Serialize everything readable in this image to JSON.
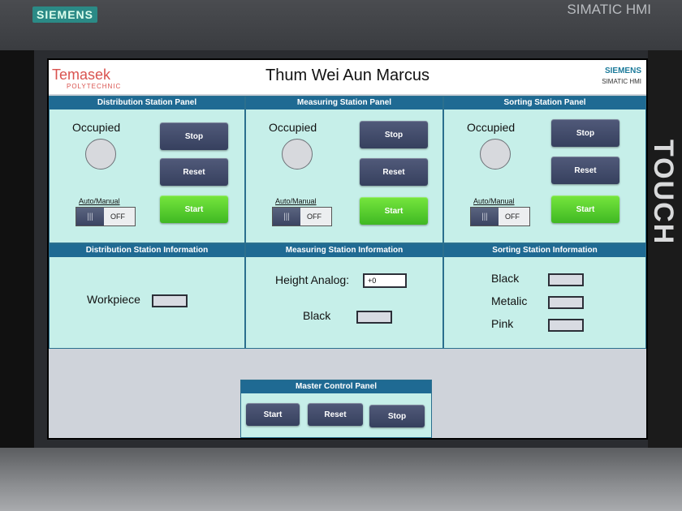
{
  "device": {
    "brand_badge": "SIEMENS",
    "hmi_label": "SIMATIC HMI",
    "touch_label": "TOUCH"
  },
  "header": {
    "logo_text": "Temasek",
    "logo_sub": "POLYTECHNIC",
    "title": "Thum Wei Aun Marcus",
    "corner_brand": "SIEMENS",
    "corner_sub": "SIMATIC HMI"
  },
  "stations": [
    {
      "panel_title": "Distribution Station Panel",
      "status_label": "Occupied",
      "stop_label": "Stop",
      "reset_label": "Reset",
      "start_label": "Start",
      "mode_label": "Auto/Manual",
      "toggle_state": "OFF"
    },
    {
      "panel_title": "Measuring Station Panel",
      "status_label": "Occupied",
      "stop_label": "Stop",
      "reset_label": "Reset",
      "start_label": "Start",
      "mode_label": "Auto/Manual",
      "toggle_state": "OFF"
    },
    {
      "panel_title": "Sorting Station Panel",
      "status_label": "Occupied",
      "stop_label": "Stop",
      "reset_label": "Reset",
      "start_label": "Start",
      "mode_label": "Auto/Manual",
      "toggle_state": "OFF"
    }
  ],
  "info": {
    "distribution": {
      "title": "Distribution Station Information",
      "workpiece_label": "Workpiece"
    },
    "measuring": {
      "title": "Measuring Station Information",
      "height_label": "Height Analog:",
      "height_value": "+0",
      "black_label": "Black"
    },
    "sorting": {
      "title": "Sorting Station Information",
      "black_label": "Black",
      "metalic_label": "Metalic",
      "pink_label": "Pink"
    }
  },
  "master": {
    "title": "Master Control Panel",
    "start_label": "Start",
    "reset_label": "Reset",
    "stop_label": "Stop"
  },
  "colors": {
    "panel_bg": "#c6efe9",
    "header_bg": "#1f6a93",
    "start_green": "#3fb823",
    "button_dark": "#36405e"
  }
}
